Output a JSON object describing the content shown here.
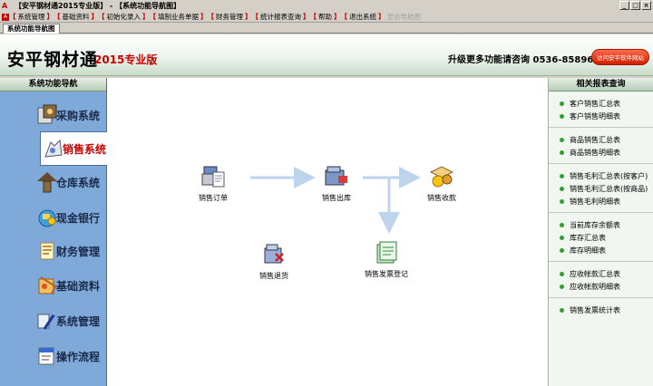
{
  "window": {
    "title": "【安平钢材通2015专业版】 - 【系统功能导航图】",
    "controls": [
      "_",
      "□",
      "×"
    ]
  },
  "menubar": {
    "items": [
      "系统管理",
      "基础资料",
      "初始化录入",
      "填制业务单据",
      "财务管理",
      "统计报表查询",
      "帮助",
      "退出系统",
      "显示导航图"
    ]
  },
  "tab": {
    "label": "系统功能导航图"
  },
  "header": {
    "brand": "安平钢材通",
    "edition": "2015专业版",
    "upgrade_text": "升级更多功能请咨询 0536-8589685",
    "visit_button": "访问安平软件网站"
  },
  "leftnav": {
    "title": "系统功能导航",
    "items": [
      {
        "label": "采购系统",
        "icon": "purchase-icon"
      },
      {
        "label": "销售系统",
        "icon": "sales-icon"
      },
      {
        "label": "仓库系统",
        "icon": "warehouse-icon"
      },
      {
        "label": "现金银行",
        "icon": "cash-bank-icon"
      },
      {
        "label": "财务管理",
        "icon": "finance-icon"
      },
      {
        "label": "基础资料",
        "icon": "basic-data-icon"
      },
      {
        "label": "系统管理",
        "icon": "system-admin-icon"
      },
      {
        "label": "操作流程",
        "icon": "workflow-icon"
      }
    ],
    "active": "销售系统"
  },
  "flow": {
    "nodes": {
      "order": "销售订单",
      "outbound": "销售出库",
      "receipt": "销售收款",
      "return": "销售退货",
      "invoice": "销售发票登记"
    }
  },
  "rightpanel": {
    "title": "相关报表查询",
    "groups": [
      [
        "客户销售汇总表",
        "客户销售明细表"
      ],
      [
        "商品销售汇总表",
        "商品销售明细表"
      ],
      [
        "销售毛利汇总表(按客户)",
        "销售毛利汇总表(按商品)",
        "销售毛利明细表"
      ],
      [
        "当前库存余额表",
        "库存汇总表",
        "库存明细表"
      ],
      [
        "应收帐款汇总表",
        "应收帐款明细表"
      ],
      [
        "销售发票统计表"
      ]
    ]
  },
  "colors": {
    "nav_bg": "#7fa9d9",
    "accent_red": "#cc0000",
    "link_dot": "#2aa52a",
    "flow_arrow": "#bcd5ec"
  }
}
